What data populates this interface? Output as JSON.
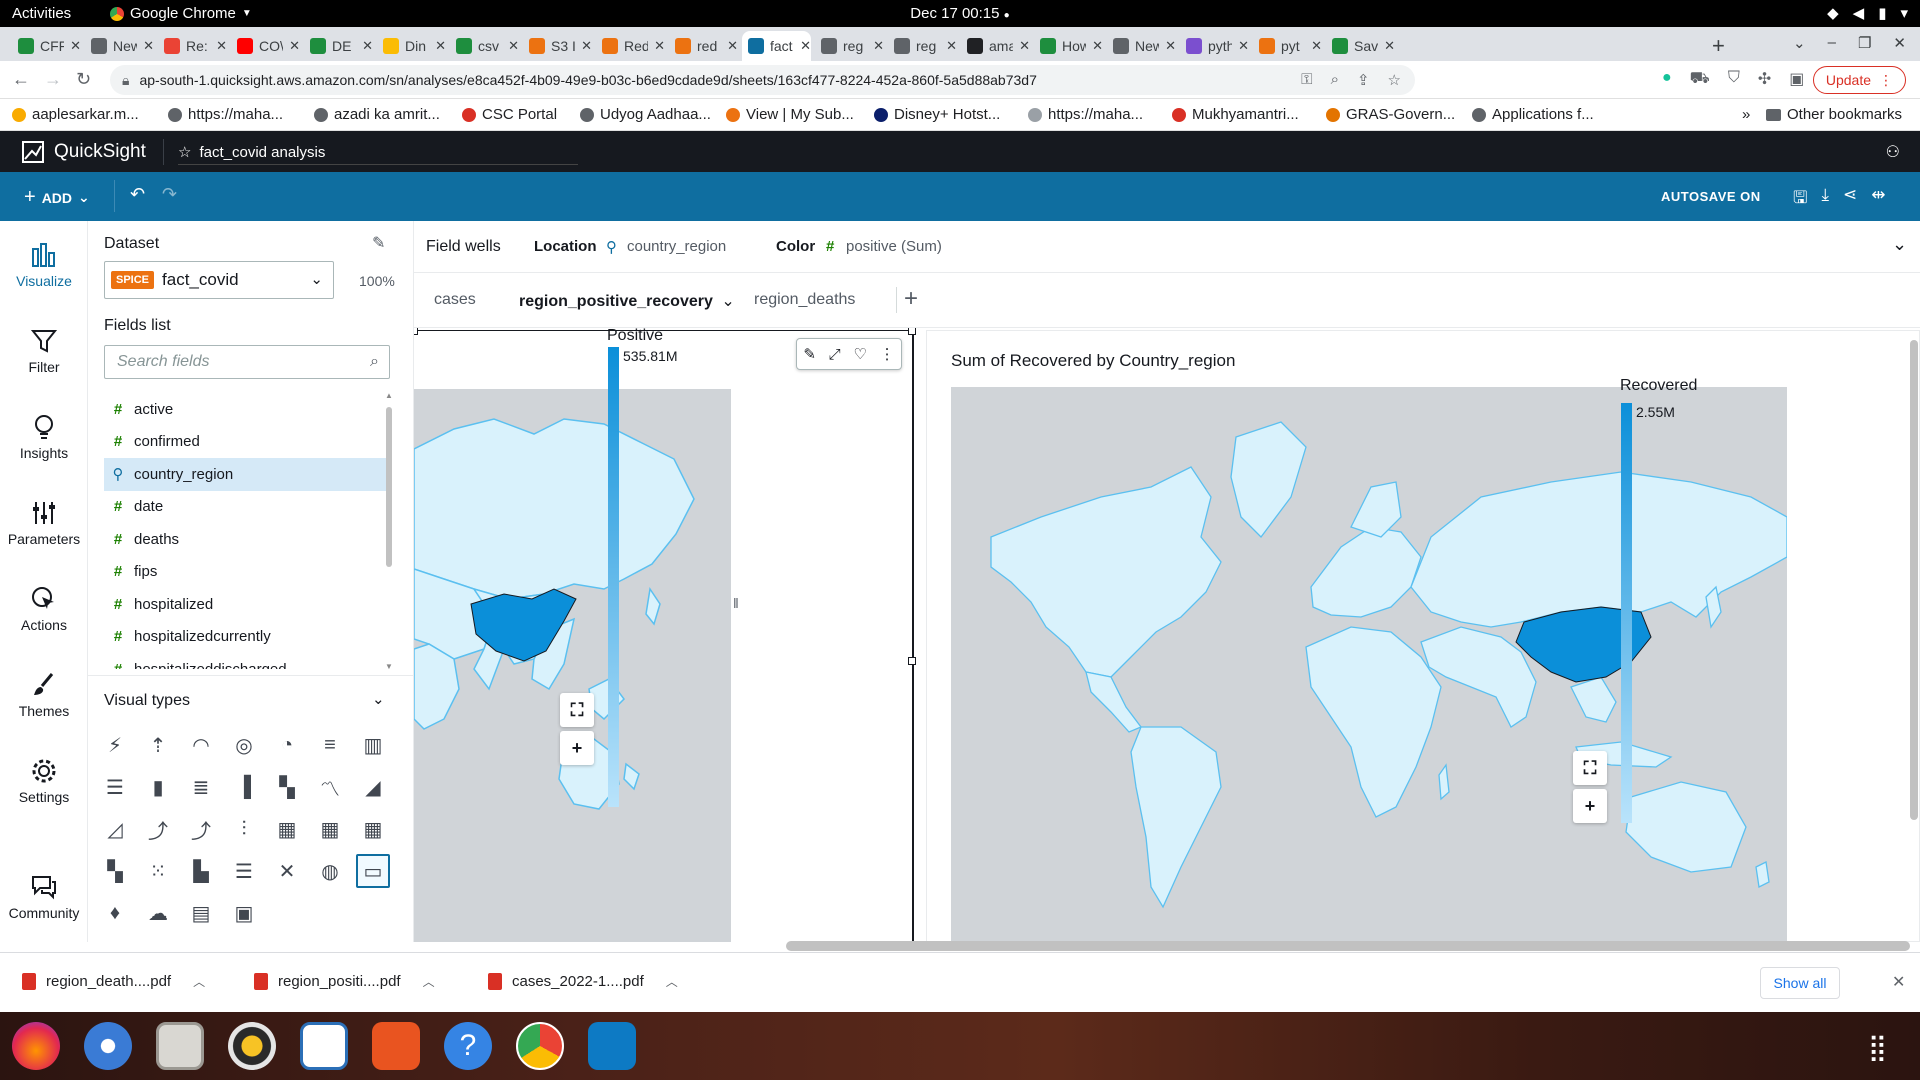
{
  "os": {
    "activities": "Activities",
    "app_name": "Google Chrome",
    "clock": "Dec 17  00:15"
  },
  "browser": {
    "tabs": [
      {
        "label": "CFF",
        "color": "#1e8e3e"
      },
      {
        "label": "New",
        "color": "#5f6368"
      },
      {
        "label": "Re:",
        "color": "#ea4335"
      },
      {
        "label": "CO\\",
        "color": "#ff0000"
      },
      {
        "label": "DE",
        "color": "#1e8e3e"
      },
      {
        "label": "Din",
        "color": "#fbbc04"
      },
      {
        "label": "csv",
        "color": "#1e8e3e"
      },
      {
        "label": "S3 I",
        "color": "#ec7211"
      },
      {
        "label": "Red",
        "color": "#ec7211"
      },
      {
        "label": "red",
        "color": "#ec7211"
      },
      {
        "label": "fact",
        "color": "#0f6ea0"
      },
      {
        "label": "reg",
        "color": "#5f6368"
      },
      {
        "label": "reg",
        "color": "#5f6368"
      },
      {
        "label": "ama",
        "color": "#202124"
      },
      {
        "label": "How",
        "color": "#1e8e3e"
      },
      {
        "label": "New",
        "color": "#5f6368"
      },
      {
        "label": "pyth",
        "color": "#7b4fcf"
      },
      {
        "label": "pyt",
        "color": "#ec7211"
      },
      {
        "label": "Sav",
        "color": "#1e8e3e"
      }
    ],
    "url": "ap-south-1.quicksight.aws.amazon.com/sn/analyses/e8ca452f-4b09-49e9-b03c-b6ed9cdade9d/sheets/163cf477-8224-452a-860f-5a5d88ab73d7",
    "update_label": "Update",
    "bookmarks": [
      {
        "label": "aaplesarkar.m...",
        "color": "#f9ab00"
      },
      {
        "label": "https://maha...",
        "color": "#5f6368"
      },
      {
        "label": "azadi ka amrit...",
        "color": "#5f6368"
      },
      {
        "label": "CSC Portal",
        "color": "#d93025"
      },
      {
        "label": "Udyog Aadhaa...",
        "color": "#5f6368"
      },
      {
        "label": "View | My Sub...",
        "color": "#ec7211"
      },
      {
        "label": "Disney+ Hotst...",
        "color": "#0b1f6b"
      },
      {
        "label": "https://maha...",
        "color": "#9aa0a6"
      },
      {
        "label": "Mukhyamantri...",
        "color": "#d93025"
      },
      {
        "label": "GRAS-Govern...",
        "color": "#e37400"
      },
      {
        "label": "Applications f...",
        "color": "#5f6368"
      }
    ],
    "other_bookmarks": "Other bookmarks",
    "downloads": [
      {
        "label": "region_death....pdf"
      },
      {
        "label": "region_positi....pdf"
      },
      {
        "label": "cases_2022-1....pdf"
      }
    ],
    "show_all": "Show all"
  },
  "app": {
    "brand": "QuickSight",
    "analysis_name": "fact_covid analysis",
    "add_label": "ADD",
    "autosave_label": "AUTOSAVE ON"
  },
  "rail": [
    {
      "label": "Visualize",
      "icon": "bar-chart-icon"
    },
    {
      "label": "Filter",
      "icon": "filter-icon"
    },
    {
      "label": "Insights",
      "icon": "lightbulb-icon"
    },
    {
      "label": "Parameters",
      "icon": "sliders-icon"
    },
    {
      "label": "Actions",
      "icon": "cursor-click-icon"
    },
    {
      "label": "Themes",
      "icon": "brush-icon"
    },
    {
      "label": "Settings",
      "icon": "gear-icon"
    },
    {
      "label": "Community",
      "icon": "chat-icon"
    }
  ],
  "dataset": {
    "title": "Dataset",
    "badge": "SPICE",
    "name": "fact_covid",
    "percent": "100%",
    "fields_title": "Fields list",
    "search_placeholder": "Search fields",
    "fields": [
      {
        "name": "active",
        "type": "measure"
      },
      {
        "name": "confirmed",
        "type": "measure"
      },
      {
        "name": "country_region",
        "type": "geo",
        "selected": true
      },
      {
        "name": "date",
        "type": "measure"
      },
      {
        "name": "deaths",
        "type": "measure"
      },
      {
        "name": "fips",
        "type": "measure"
      },
      {
        "name": "hospitalized",
        "type": "measure"
      },
      {
        "name": "hospitalizedcurrently",
        "type": "measure"
      },
      {
        "name": "hospitalizeddischarged",
        "type": "measure"
      }
    ]
  },
  "visual_types": {
    "title": "Visual types",
    "selected_index": 27,
    "count": 32
  },
  "wells": {
    "title": "Field wells",
    "location_label": "Location",
    "location_value": "country_region",
    "color_label": "Color",
    "color_value": "positive (Sum)"
  },
  "sheets": [
    {
      "label": "cases"
    },
    {
      "label": "region_positive_recovery",
      "selected": true
    },
    {
      "label": "region_deaths"
    }
  ],
  "visuals": [
    {
      "title": "",
      "legend_title": "Positive",
      "legend_max": "535.81M",
      "highlight_color": "#0b8fd9"
    },
    {
      "title": "Sum of Recovered by Country_region",
      "legend_title": "Recovered",
      "legend_max": "2.55M",
      "highlight_color": "#0b8fd9"
    }
  ],
  "colors": {
    "accent": "#0f6ea0",
    "land": "#d9f2fc",
    "border": "#5bc0f0",
    "water": "#d0d4d8"
  }
}
